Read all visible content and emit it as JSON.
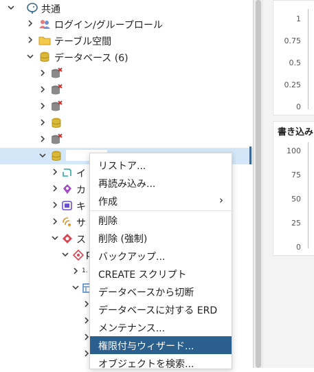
{
  "tree": {
    "root_label": "共通",
    "login_roles": "ログイン/グループロール",
    "tablespaces": "テーブル空間",
    "databases": "データベース (6)",
    "child_snippets": [
      "イ",
      "カ",
      "キ",
      "サ",
      "ス",
      "p",
      "1."
    ]
  },
  "menu": {
    "items": [
      "リストア...",
      "再読み込み...",
      "作成",
      "削除",
      "削除 (強制)",
      "バックアップ...",
      "CREATE スクリプト",
      "データベースから切断",
      "データベースに対する ERD",
      "メンテナンス...",
      "権限付与ウィザード...",
      "オブジェクトを検索..."
    ],
    "submenu_arrow": "›",
    "active_item": "権限付与ウィザード..."
  },
  "chart1": {
    "ticks": [
      "1",
      "0.75",
      "0.5",
      "0.25",
      "0"
    ]
  },
  "chart2": {
    "title": "書き込み",
    "ticks": [
      "100",
      "75",
      "50",
      "25",
      "0"
    ]
  },
  "colors": {
    "selection": "#d4e7f8",
    "menu_active": "#2b5f8e",
    "db_icon": "#c9a227",
    "error_mark": "#d0312d"
  }
}
